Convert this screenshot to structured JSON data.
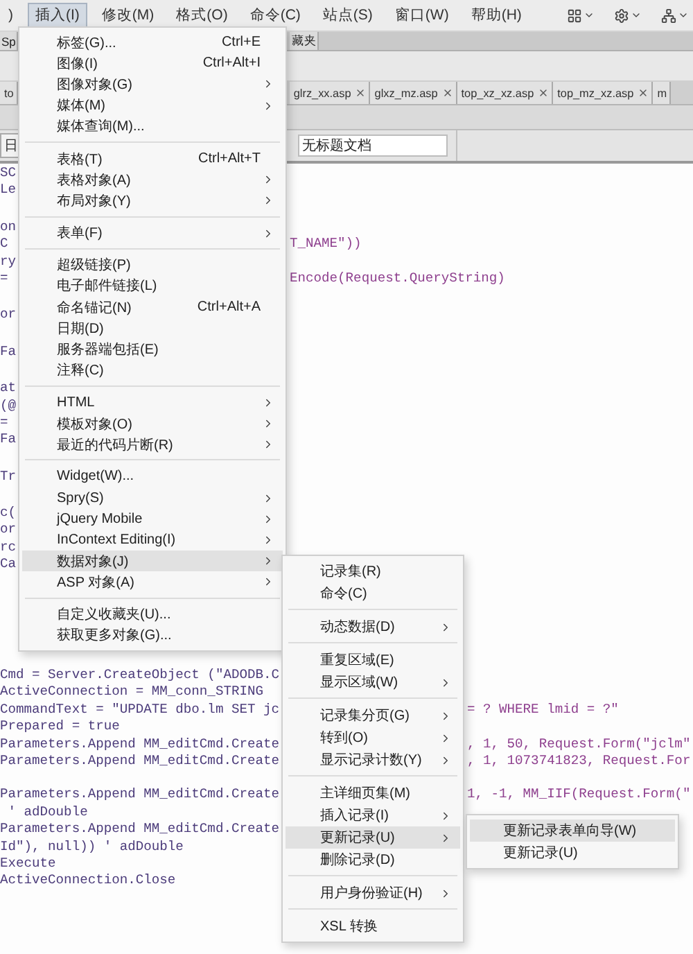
{
  "menubar": {
    "items": [
      {
        "label": ")",
        "selected": false
      },
      {
        "label": "插入(I)",
        "selected": true
      },
      {
        "label": "修改(M)",
        "selected": false
      },
      {
        "label": "格式(O)",
        "selected": false
      },
      {
        "label": "命令(C)",
        "selected": false
      },
      {
        "label": "站点(S)",
        "selected": false
      },
      {
        "label": "窗口(W)",
        "selected": false
      },
      {
        "label": "帮助(H)",
        "selected": false
      }
    ]
  },
  "panel_tabs": [
    "Sp",
    "藏夹"
  ],
  "file_tabs": {
    "lead": "to",
    "tabs": [
      "glrz_xx.asp",
      "glxz_mz.asp",
      "top_xz_xz.asp",
      "top_mz_xz.asp"
    ],
    "trail": "m"
  },
  "toolbar": {
    "lead": "日",
    "title_field": {
      "value": "无标题文档"
    }
  },
  "code_top": [
    [
      {
        "left": "SC"
      },
      {
        "left": "Le"
      }
    ],
    [
      {
        "left": "on"
      },
      {
        "left": "C",
        "right": "T_NAME\"))"
      },
      {
        "left": "ry"
      },
      {
        "left": "=",
        "right": "Encode(Request.QueryString)"
      }
    ],
    [
      {
        "left": "or"
      }
    ],
    [
      {
        "left": "Fa"
      }
    ],
    [
      {
        "left": "at"
      },
      {
        "left": "(@"
      },
      {
        "left": "="
      },
      {
        "left": "Fa"
      }
    ],
    [
      {
        "left": "Tr"
      }
    ],
    [
      {
        "left": "c("
      },
      {
        "left": "or"
      },
      {
        "left": "rc"
      },
      {
        "left": "Ca"
      }
    ]
  ],
  "code_bottom": [
    [
      {
        "left": "Cmd = Server.CreateObject (\"ADODB.C"
      },
      {
        "left": "ActiveConnection = MM_conn_STRING"
      },
      {
        "left": "CommandText = \"UPDATE dbo.lm SET jc",
        "right": "= ? WHERE lmid = ?\""
      },
      {
        "left": "Prepared = true"
      },
      {
        "left": "Parameters.Append MM_editCmd.Create",
        "right": ", 1, 50, Request.Form(\"jclm\""
      },
      {
        "left": "Parameters.Append MM_editCmd.Create",
        "right": ", 1, 1073741823, Request.For"
      }
    ],
    [
      {
        "left": "Parameters.Append MM_editCmd.Create",
        "right": "1, -1, MM_IIF(Request.Form(\""
      },
      {
        "left": " ' adDouble"
      },
      {
        "left": "Parameters.Append MM_editCmd.Create"
      },
      {
        "left": "Id\"), null)) ' adDouble"
      },
      {
        "left": "Execute"
      },
      {
        "left": "ActiveConnection.Close"
      }
    ]
  ],
  "insert_menu": {
    "groups": [
      [
        {
          "label": "标签(G)...",
          "shortcut": "Ctrl+E",
          "submenu": false,
          "selected": false
        },
        {
          "label": "图像(I)",
          "shortcut": "Ctrl+Alt+I",
          "submenu": false,
          "selected": false
        },
        {
          "label": "图像对象(G)",
          "submenu": true,
          "selected": false
        },
        {
          "label": "媒体(M)",
          "submenu": true,
          "selected": false
        },
        {
          "label": "媒体查询(M)...",
          "submenu": false,
          "selected": false
        }
      ],
      [
        {
          "label": "表格(T)",
          "shortcut": "Ctrl+Alt+T",
          "submenu": false,
          "selected": false
        },
        {
          "label": "表格对象(A)",
          "submenu": true,
          "selected": false
        },
        {
          "label": "布局对象(Y)",
          "submenu": true,
          "selected": false
        }
      ],
      [
        {
          "label": "表单(F)",
          "submenu": true,
          "selected": false
        }
      ],
      [
        {
          "label": "超级链接(P)",
          "submenu": false,
          "selected": false
        },
        {
          "label": "电子邮件链接(L)",
          "submenu": false,
          "selected": false
        },
        {
          "label": "命名锚记(N)",
          "shortcut": "Ctrl+Alt+A",
          "submenu": false,
          "selected": false
        },
        {
          "label": "日期(D)",
          "submenu": false,
          "selected": false
        },
        {
          "label": "服务器端包括(E)",
          "submenu": false,
          "selected": false
        },
        {
          "label": "注释(C)",
          "submenu": false,
          "selected": false
        }
      ],
      [
        {
          "label": "HTML",
          "submenu": true,
          "selected": false
        },
        {
          "label": "模板对象(O)",
          "submenu": true,
          "selected": false
        },
        {
          "label": "最近的代码片断(R)",
          "submenu": true,
          "selected": false
        }
      ],
      [
        {
          "label": "Widget(W)...",
          "submenu": false,
          "selected": false
        },
        {
          "label": "Spry(S)",
          "submenu": true,
          "selected": false
        },
        {
          "label": "jQuery Mobile",
          "submenu": true,
          "selected": false
        },
        {
          "label": "InContext Editing(I)",
          "submenu": true,
          "selected": false
        },
        {
          "label": "数据对象(J)",
          "submenu": true,
          "selected": true
        },
        {
          "label": "ASP 对象(A)",
          "submenu": true,
          "selected": false
        }
      ],
      [
        {
          "label": "自定义收藏夹(U)...",
          "submenu": false,
          "selected": false
        },
        {
          "label": "获取更多对象(G)...",
          "submenu": false,
          "selected": false
        }
      ]
    ]
  },
  "data_objects_menu": {
    "groups": [
      [
        {
          "label": "记录集(R)",
          "submenu": false,
          "selected": false
        },
        {
          "label": "命令(C)",
          "submenu": false,
          "selected": false
        }
      ],
      [
        {
          "label": "动态数据(D)",
          "submenu": true,
          "selected": false
        }
      ],
      [
        {
          "label": "重复区域(E)",
          "submenu": false,
          "selected": false
        },
        {
          "label": "显示区域(W)",
          "submenu": true,
          "selected": false
        }
      ],
      [
        {
          "label": "记录集分页(G)",
          "submenu": true,
          "selected": false
        },
        {
          "label": "转到(O)",
          "submenu": true,
          "selected": false
        },
        {
          "label": "显示记录计数(Y)",
          "submenu": true,
          "selected": false
        }
      ],
      [
        {
          "label": "主详细页集(M)",
          "submenu": false,
          "selected": false
        },
        {
          "label": "插入记录(I)",
          "submenu": true,
          "selected": false
        },
        {
          "label": "更新记录(U)",
          "submenu": true,
          "selected": true
        },
        {
          "label": "删除记录(D)",
          "submenu": false,
          "selected": false
        }
      ],
      [
        {
          "label": "用户身份验证(H)",
          "submenu": true,
          "selected": false
        }
      ],
      [
        {
          "label": "XSL 转换",
          "submenu": false,
          "selected": false
        }
      ]
    ]
  },
  "update_record_menu": {
    "groups": [
      [
        {
          "label": "更新记录表单向导(W)",
          "submenu": false,
          "selected": true
        },
        {
          "label": "更新记录(U)",
          "submenu": false,
          "selected": false
        }
      ]
    ]
  }
}
